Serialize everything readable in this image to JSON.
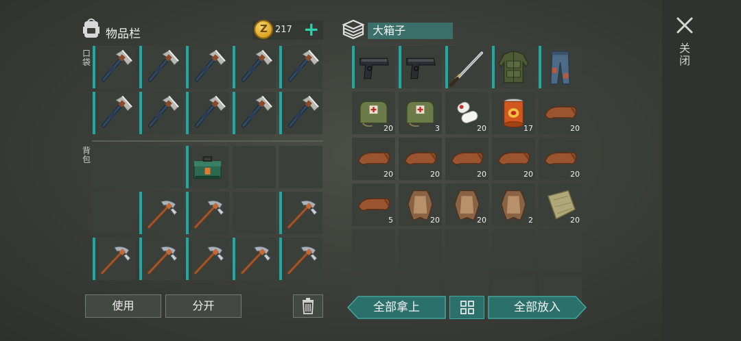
{
  "inventory": {
    "title": "物品栏",
    "pocket_label": "口袋",
    "backpack_label": "背包"
  },
  "currency": {
    "amount": "217",
    "coin_letter": "Z"
  },
  "container": {
    "name": "大箱子"
  },
  "close": {
    "label": "关闭"
  },
  "buttons": {
    "use": "使用",
    "split": "分开",
    "take_all": "全部拿上",
    "put_all": "全部放入"
  },
  "pocket_slots": [
    {
      "item": "hatchet-icon"
    },
    {
      "item": "hatchet-icon"
    },
    {
      "item": "hatchet-icon"
    },
    {
      "item": "hatchet-icon"
    },
    {
      "item": "hatchet-icon"
    },
    {
      "item": "hatchet-icon"
    },
    {
      "item": "hatchet-icon"
    },
    {
      "item": "hatchet-icon"
    },
    {
      "item": "hatchet-icon"
    },
    {
      "item": "hatchet-icon"
    }
  ],
  "backpack_slots": [
    {
      "item": ""
    },
    {
      "item": ""
    },
    {
      "item": "toolbox-icon"
    },
    {
      "item": ""
    },
    {
      "item": ""
    },
    {
      "item": ""
    },
    {
      "item": "pickaxe-icon"
    },
    {
      "item": "pickaxe-icon"
    },
    {
      "item": ""
    },
    {
      "item": "pickaxe-icon"
    },
    {
      "item": "pickaxe-icon"
    },
    {
      "item": "pickaxe-icon"
    },
    {
      "item": "pickaxe-icon"
    },
    {
      "item": "pickaxe-icon"
    },
    {
      "item": "pickaxe-icon"
    }
  ],
  "box_slots": [
    {
      "item": "pistol-icon",
      "count": ""
    },
    {
      "item": "pistol-icon",
      "count": ""
    },
    {
      "item": "katana-icon",
      "count": ""
    },
    {
      "item": "armor-vest-icon",
      "count": ""
    },
    {
      "item": "pants-icon",
      "count": ""
    },
    {
      "item": "medkit-icon",
      "count": "20"
    },
    {
      "item": "medkit-icon",
      "count": "3"
    },
    {
      "item": "bandage-icon",
      "count": "20"
    },
    {
      "item": "canned-food-icon",
      "count": "17"
    },
    {
      "item": "leather-icon",
      "count": "20"
    },
    {
      "item": "leather-icon",
      "count": "20"
    },
    {
      "item": "leather-icon",
      "count": "20"
    },
    {
      "item": "leather-icon",
      "count": "20"
    },
    {
      "item": "leather-icon",
      "count": "20"
    },
    {
      "item": "leather-icon",
      "count": "20"
    },
    {
      "item": "leather-icon",
      "count": "5"
    },
    {
      "item": "hide-icon",
      "count": "20"
    },
    {
      "item": "hide-icon",
      "count": "20"
    },
    {
      "item": "hide-icon",
      "count": "2"
    },
    {
      "item": "cloth-icon",
      "count": "20"
    },
    {
      "item": "",
      "count": ""
    },
    {
      "item": "",
      "count": ""
    },
    {
      "item": "",
      "count": ""
    },
    {
      "item": "",
      "count": ""
    },
    {
      "item": "",
      "count": ""
    },
    {
      "item": "",
      "count": ""
    },
    {
      "item": "",
      "count": ""
    },
    {
      "item": "",
      "count": ""
    },
    {
      "item": "",
      "count": ""
    },
    {
      "item": "",
      "count": ""
    }
  ],
  "colors": {
    "accent": "#1fa9a5",
    "plus": "#2fd1ad",
    "container_field": "#3b6f69"
  }
}
